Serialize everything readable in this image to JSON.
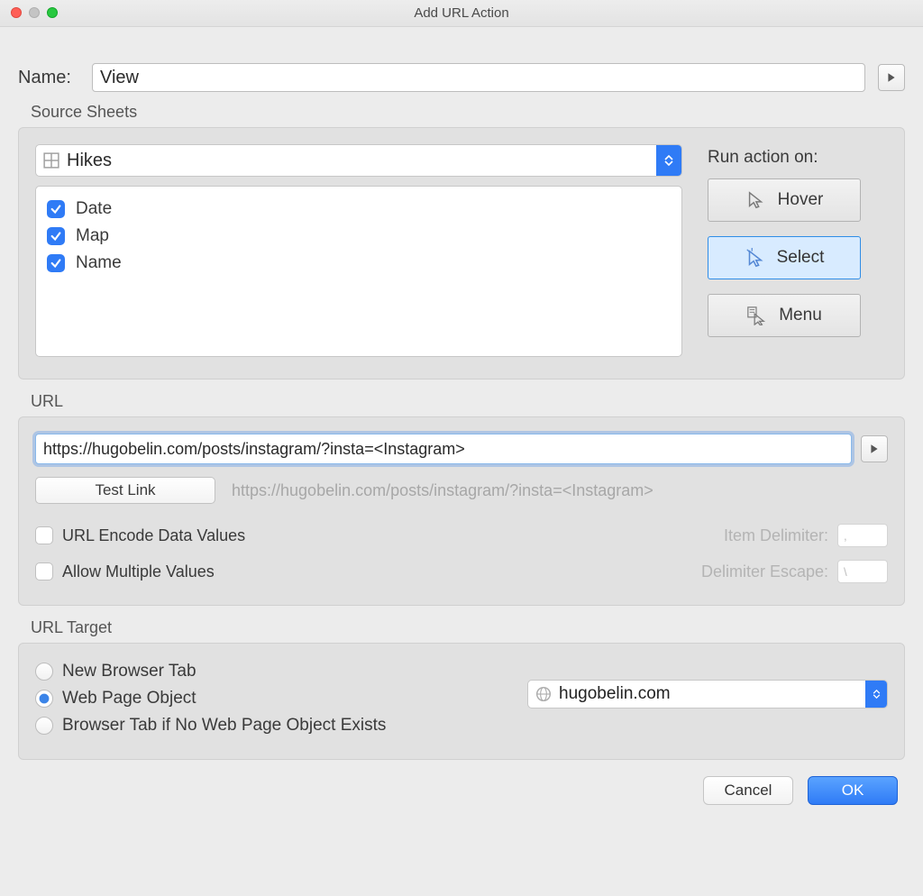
{
  "window": {
    "title": "Add URL Action"
  },
  "name": {
    "label": "Name:",
    "value": "View"
  },
  "source": {
    "section_label": "Source Sheets",
    "sheet_selected": "Hikes",
    "fields": [
      "Date",
      "Map",
      "Name"
    ],
    "runon_label": "Run action on:",
    "actions": {
      "hover": "Hover",
      "select": "Select",
      "menu": "Menu"
    }
  },
  "url": {
    "section_label": "URL",
    "value": "https://hugobelin.com/posts/instagram/?insta=<Instagram>",
    "test_label": "Test Link",
    "preview": "https://hugobelin.com/posts/instagram/?insta=<Instagram>",
    "encode_label": "URL Encode Data Values",
    "multiple_label": "Allow Multiple Values",
    "item_delim_label": "Item Delimiter:",
    "item_delim_value": ",",
    "delim_escape_label": "Delimiter Escape:",
    "delim_escape_value": "\\"
  },
  "target": {
    "section_label": "URL Target",
    "radios": {
      "new_tab": "New Browser Tab",
      "web_page": "Web Page Object",
      "fallback": "Browser Tab if No Web Page Object Exists"
    },
    "selected": "hugobelin.com"
  },
  "footer": {
    "cancel": "Cancel",
    "ok": "OK"
  }
}
